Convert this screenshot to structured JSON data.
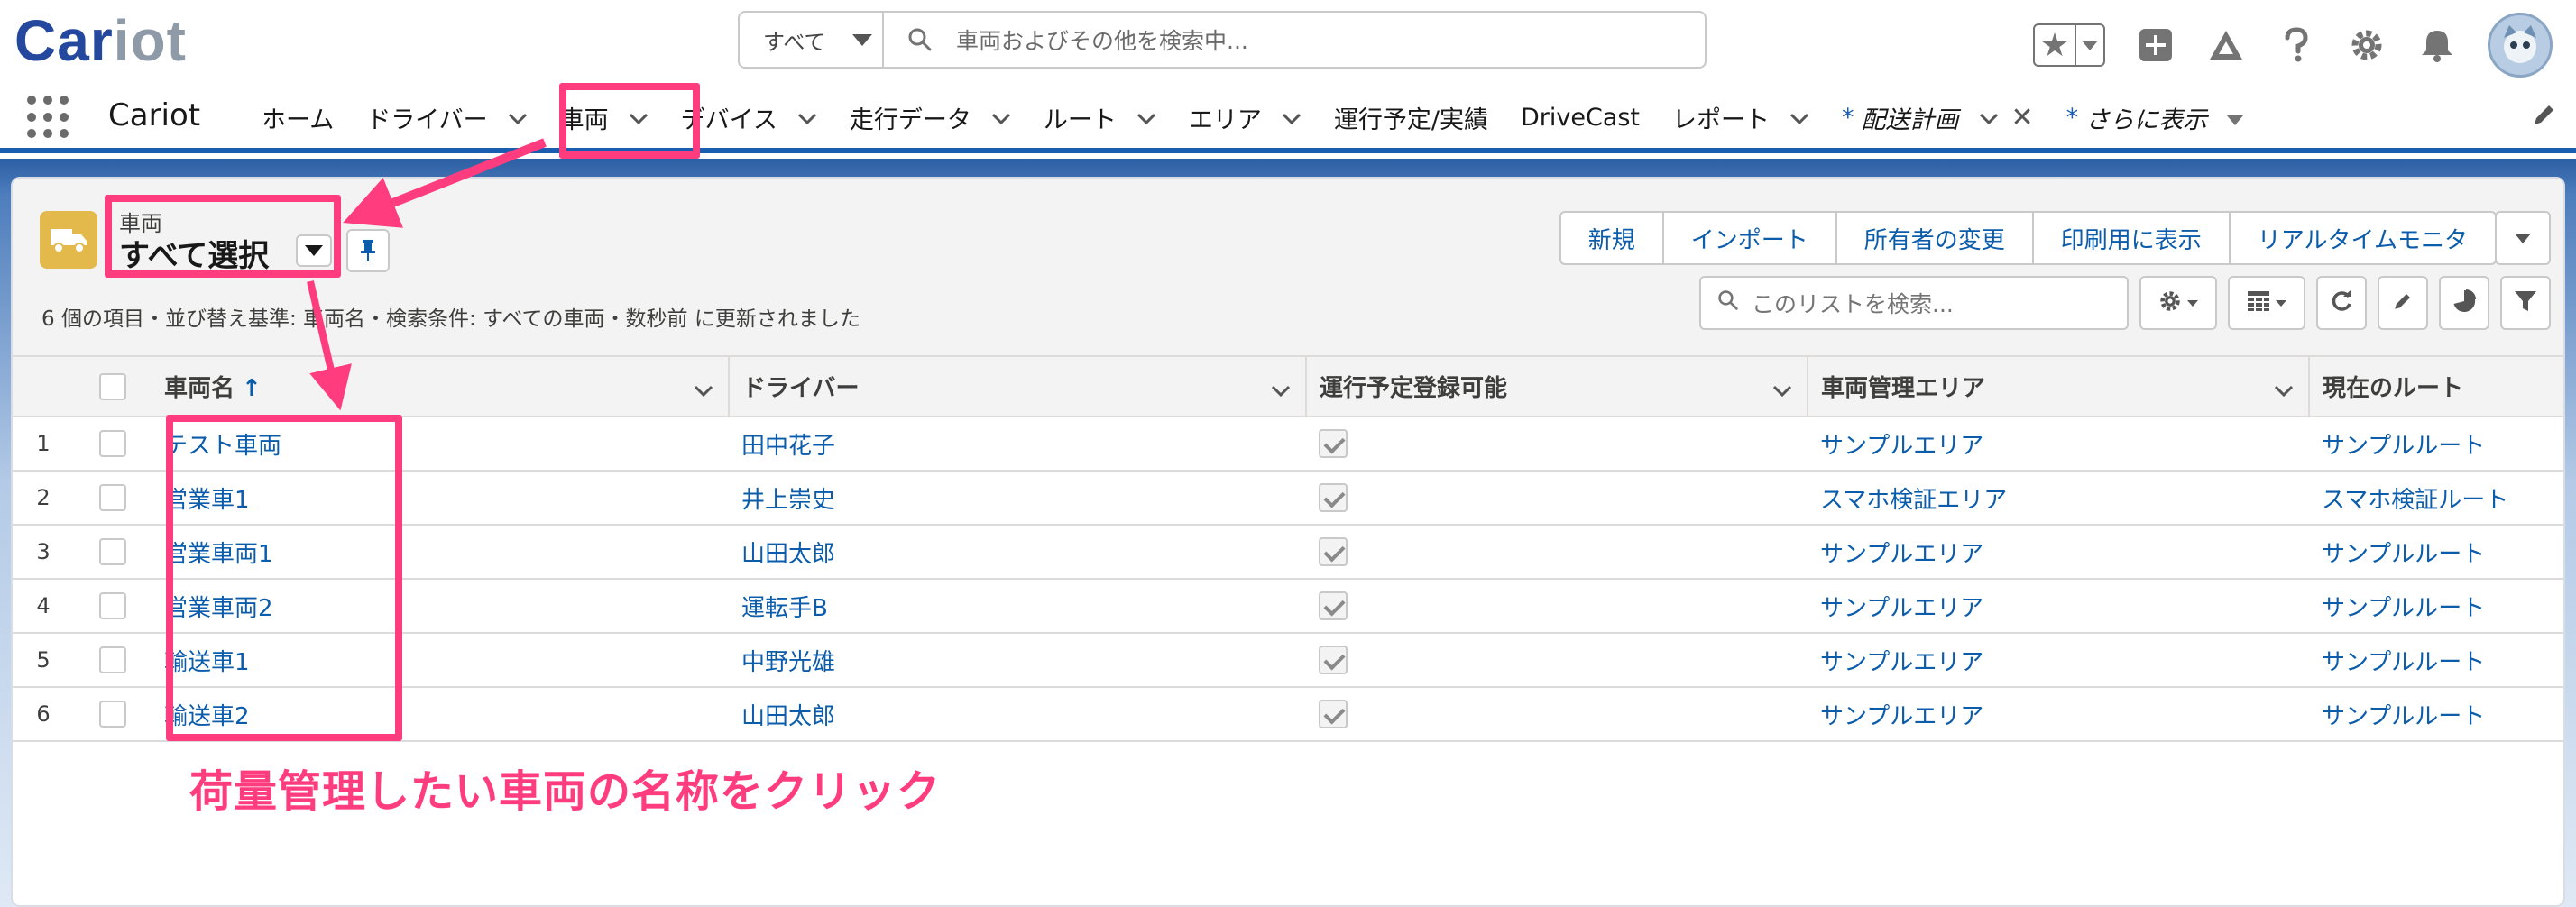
{
  "header": {
    "logo_main": "Car",
    "logo_lite": "iot",
    "search_scope": "すべて",
    "search_placeholder": "車両およびその他を検索中..."
  },
  "nav": {
    "app_name": "Cariot",
    "items": [
      {
        "label": "ホーム",
        "has_chevron": false
      },
      {
        "label": "ドライバー",
        "has_chevron": true
      },
      {
        "label": "車両",
        "has_chevron": true,
        "active": true
      },
      {
        "label": "デバイス",
        "has_chevron": true
      },
      {
        "label": "走行データ",
        "has_chevron": true
      },
      {
        "label": "ルート",
        "has_chevron": true
      },
      {
        "label": "エリア",
        "has_chevron": true
      },
      {
        "label": "運行予定/実績",
        "has_chevron": false
      },
      {
        "label": "DriveCast",
        "has_chevron": false
      },
      {
        "label": "レポート",
        "has_chevron": true
      }
    ],
    "temp_tab": {
      "prefix": "*",
      "label": "配送計画"
    },
    "more_tab": {
      "prefix": "*",
      "label": "さらに表示"
    }
  },
  "list_view": {
    "object_label": "車両",
    "view_name": "すべて選択",
    "meta": "6 個の項目・並び替え基準: 車両名・検索条件: すべての車両・数秒前 に更新されました",
    "actions": [
      "新規",
      "インポート",
      "所有者の変更",
      "印刷用に表示",
      "リアルタイムモニタ"
    ],
    "search_placeholder": "このリストを検索...",
    "columns": [
      "車両名",
      "ドライバー",
      "運行予定登録可能",
      "車両管理エリア",
      "現在のルート"
    ],
    "sort_indicator": "↑",
    "rows": [
      {
        "num": "1",
        "name": "テスト車両",
        "driver": "田中花子",
        "bookable": true,
        "area": "サンプルエリア",
        "route": "サンプルルート"
      },
      {
        "num": "2",
        "name": "営業車1",
        "driver": "井上崇史",
        "bookable": true,
        "area": "スマホ検証エリア",
        "route": "スマホ検証ルート"
      },
      {
        "num": "3",
        "name": "営業車両1",
        "driver": "山田太郎",
        "bookable": true,
        "area": "サンプルエリア",
        "route": "サンプルルート"
      },
      {
        "num": "4",
        "name": "営業車両2",
        "driver": "運転手B",
        "bookable": true,
        "area": "サンプルエリア",
        "route": "サンプルルート"
      },
      {
        "num": "5",
        "name": "輸送車1",
        "driver": "中野光雄",
        "bookable": true,
        "area": "サンプルエリア",
        "route": "サンプルルート"
      },
      {
        "num": "6",
        "name": "輸送車2",
        "driver": "山田太郎",
        "bookable": true,
        "area": "サンプルエリア",
        "route": "サンプルルート"
      }
    ]
  },
  "annotation": {
    "text": "荷量管理したい車両の名称をクリック",
    "color": "#ff3c7d"
  },
  "colors": {
    "brand": "#24489d",
    "link": "#0b5cab",
    "nav_accent": "#1b5eaf",
    "object_icon": "#e3b94c"
  }
}
